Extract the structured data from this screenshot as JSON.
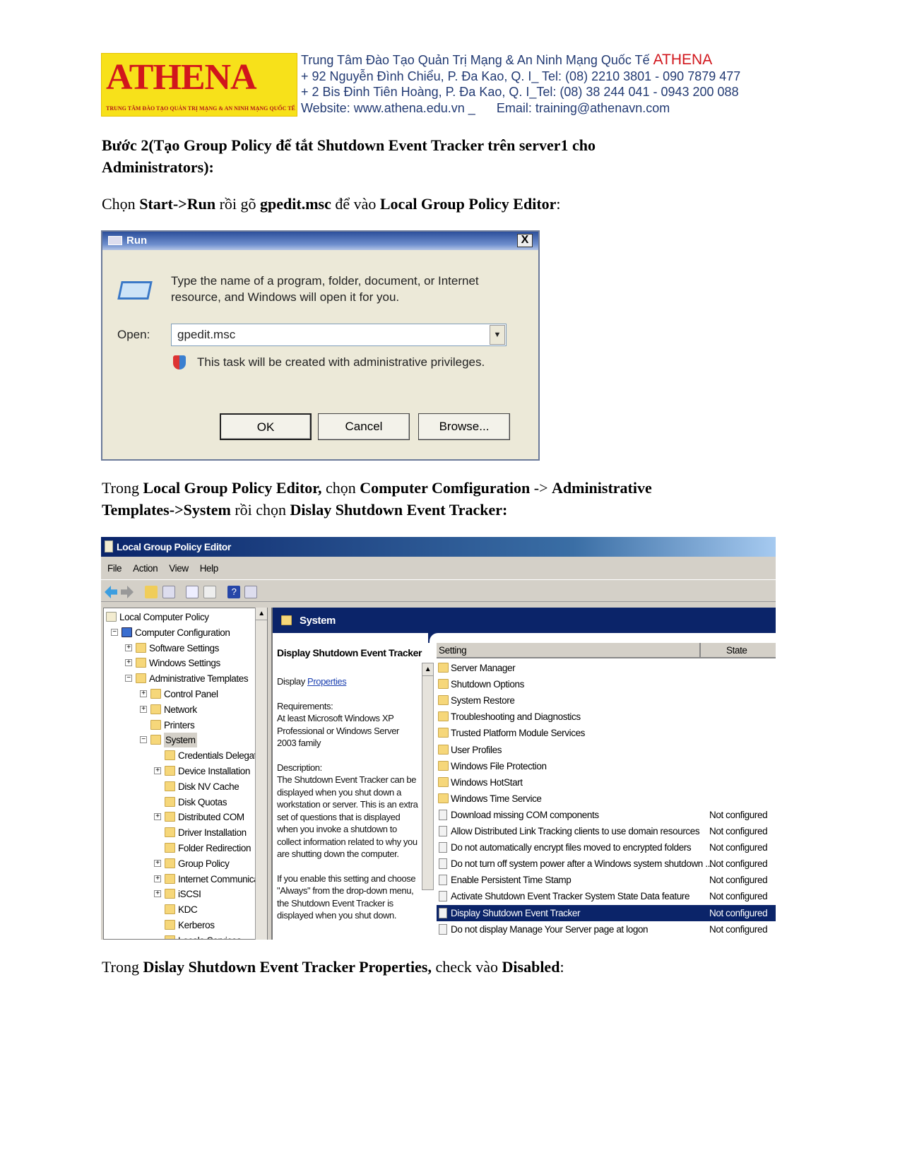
{
  "header": {
    "logo_text": "ATHENA",
    "logo_tagline": "TRUNG TÂM ĐÀO TẠO QUẢN TRỊ MẠNG & AN NINH MẠNG QUỐC TẾ",
    "line1": "Trung Tâm Đào Tạo Quản Trị Mạng & An Ninh Mạng Quốc Tế ",
    "line1_brand": "ATHENA",
    "line2": "+ 92 Nguyễn Đình Chiểu, P. Đa Kao, Q. I_ Tel: (08) 2210 3801 -  090 7879 477",
    "line3": "+ 2 Bis Đinh Tiên Hoàng, P. Đa Kao, Q. I_Tel: (08) 38 244 041 - 0943 200 088",
    "website": "Website: www.athena.edu.vn    _",
    "email": "Email: training@athenavn.com"
  },
  "text": {
    "step_title_1": "Bước 2(Tạo Group Policy để tắt Shutdown Event Tracker trên server1 cho",
    "step_title_2": "Administrators):",
    "p1_a": "Chọn ",
    "p1_b": "Start->Run",
    " p1_c": " rồi gõ ",
    "p1_d": "gpedit.msc",
    "p1_e": " để vào ",
    "p1_f": "Local Group Policy Editor",
    "p1_g": ":",
    "p2_a": "Trong ",
    "p2_b": "Local Group Policy Editor,",
    "p2_c": " chọn ",
    "p2_d": "Computer Comfiguration",
    "p2_e": " -> ",
    "p2_f": "Administrative",
    "p3_a": "Templates->System",
    "p3_b": " rồi chọn ",
    "p3_c": "Dislay Shutdown Event Tracker:",
    "p4_a": "Trong ",
    "p4_b": "Dislay Shutdown Event Tracker Properties,",
    "p4_c": " check vào ",
    "p4_d": "Disabled",
    "p4_e": ":"
  },
  "run_dialog": {
    "title": "Run",
    "close": "X",
    "message": "Type the name of a program, folder, document, or Internet resource, and Windows will open it for you.",
    "open_label": "Open:",
    "open_value": "gpedit.msc",
    "admin_note": "This task will be created with administrative privileges.",
    "ok": "OK",
    "cancel": "Cancel",
    "browse": "Browse..."
  },
  "gpe": {
    "title": "Local Group Policy Editor",
    "menu": [
      "File",
      "Action",
      "View",
      "Help"
    ],
    "tree": [
      {
        "label": "Local Computer Policy",
        "level": 0,
        "exp": ""
      },
      {
        "label": "Computer Configuration",
        "level": 1,
        "exp": "-"
      },
      {
        "label": "Software Settings",
        "level": 2,
        "exp": "+"
      },
      {
        "label": "Windows Settings",
        "level": 2,
        "exp": "+"
      },
      {
        "label": "Administrative Templates",
        "level": 2,
        "exp": "-"
      },
      {
        "label": "Control Panel",
        "level": 3,
        "exp": "+"
      },
      {
        "label": "Network",
        "level": 3,
        "exp": "+"
      },
      {
        "label": "Printers",
        "level": 3,
        "exp": ""
      },
      {
        "label": "System",
        "level": 3,
        "exp": "-",
        "selected": true
      },
      {
        "label": "Credentials Delegatio",
        "level": 4,
        "exp": ""
      },
      {
        "label": "Device Installation",
        "level": 4,
        "exp": "+"
      },
      {
        "label": "Disk NV Cache",
        "level": 4,
        "exp": ""
      },
      {
        "label": "Disk Quotas",
        "level": 4,
        "exp": ""
      },
      {
        "label": "Distributed COM",
        "level": 4,
        "exp": "+"
      },
      {
        "label": "Driver Installation",
        "level": 4,
        "exp": ""
      },
      {
        "label": "Folder Redirection",
        "level": 4,
        "exp": ""
      },
      {
        "label": "Group Policy",
        "level": 4,
        "exp": "+"
      },
      {
        "label": "Internet Communicati",
        "level": 4,
        "exp": "+"
      },
      {
        "label": "iSCSI",
        "level": 4,
        "exp": "+"
      },
      {
        "label": "KDC",
        "level": 4,
        "exp": ""
      },
      {
        "label": "Kerberos",
        "level": 4,
        "exp": ""
      },
      {
        "label": "Locale Services",
        "level": 4,
        "exp": ""
      }
    ],
    "panel_title": "System",
    "desc_title": "Display Shutdown Event Tracker",
    "desc_display": "Display ",
    "desc_link": "Properties",
    "requirements": "Requirements:\nAt least Microsoft Windows XP Professional or Windows Server 2003 family",
    "description": "Description:\nThe Shutdown Event Tracker can be displayed when you shut down a workstation or server.  This is an extra set of questions that is displayed when you invoke a shutdown to collect information related to why you are shutting down the computer.",
    "description2": "If you enable this setting and choose \"Always\" from the drop-down menu, the Shutdown Event Tracker is displayed when you shut down.",
    "col_setting": "Setting",
    "col_state": "State",
    "rows": [
      {
        "name": "Server Manager",
        "type": "folder",
        "state": ""
      },
      {
        "name": "Shutdown Options",
        "type": "folder",
        "state": ""
      },
      {
        "name": "System Restore",
        "type": "folder",
        "state": ""
      },
      {
        "name": "Troubleshooting and Diagnostics",
        "type": "folder",
        "state": ""
      },
      {
        "name": "Trusted Platform Module Services",
        "type": "folder",
        "state": ""
      },
      {
        "name": "User Profiles",
        "type": "folder",
        "state": ""
      },
      {
        "name": "Windows File Protection",
        "type": "folder",
        "state": ""
      },
      {
        "name": "Windows HotStart",
        "type": "folder",
        "state": ""
      },
      {
        "name": "Windows Time Service",
        "type": "folder",
        "state": ""
      },
      {
        "name": "Download missing COM components",
        "type": "policy",
        "state": "Not configured"
      },
      {
        "name": "Allow Distributed Link Tracking clients to use domain resources",
        "type": "policy",
        "state": "Not configured"
      },
      {
        "name": "Do not automatically encrypt files moved to encrypted folders",
        "type": "policy",
        "state": "Not configured"
      },
      {
        "name": "Do not turn off system power after a Windows system shutdown ...",
        "type": "policy",
        "state": "Not configured"
      },
      {
        "name": "Enable Persistent Time Stamp",
        "type": "policy",
        "state": "Not configured"
      },
      {
        "name": "Activate Shutdown Event Tracker System State Data feature",
        "type": "policy",
        "state": "Not configured"
      },
      {
        "name": "Display Shutdown Event Tracker",
        "type": "policy",
        "state": "Not configured",
        "selected": true
      },
      {
        "name": "Do not display Manage Your Server page at logon",
        "type": "policy",
        "state": "Not configured"
      }
    ]
  }
}
